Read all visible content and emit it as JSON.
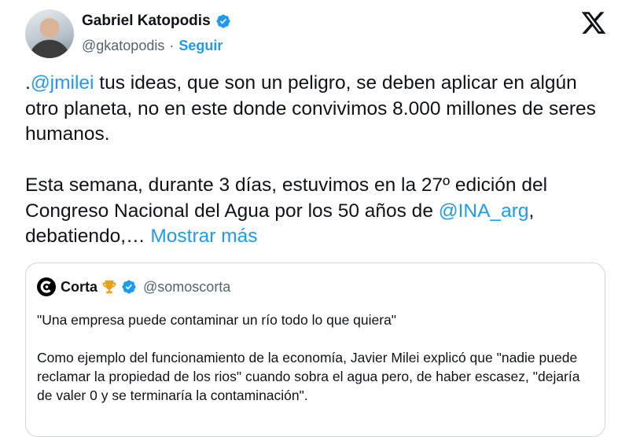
{
  "author": {
    "name": "Gabriel Katopodis",
    "handle": "@gkatopodis",
    "separator": "·",
    "follow_label": "Seguir"
  },
  "tweet": {
    "prefix": ".",
    "mention1": "@jmilei",
    "part1": " tus ideas, que son un peligro, se deben aplicar en algún otro planeta, no en este donde convivimos 8.000 millones de seres humanos.\n\nEsta semana, durante 3 días, estuvimos en la 27º edición del Congreso Nacional del Agua por los 50 años de ",
    "mention2": "@INA_arg",
    "part2": ", debatiendo,… ",
    "show_more": "Mostrar más"
  },
  "quote": {
    "name": "Corta",
    "handle": "@somoscorta",
    "line1": "\"Una empresa puede contaminar un río todo lo que quiera\"",
    "paragraph": "Como ejemplo del funcionamiento de la economía, Javier Milei explicó que \"nadie puede reclamar la propiedad de los rios\" cuando sobra el agua pero, de haber escasez, \"dejaría de valer 0 y se terminaría la contaminación\"."
  },
  "icons": {
    "verified": "verified-badge-icon",
    "x_logo": "x-logo-icon",
    "trophy": "trophy-icon",
    "corta_logo": "corta-logo-icon"
  },
  "colors": {
    "accent": "#1d9bf0",
    "text": "#0f1419",
    "secondary": "#536471",
    "border": "#cfd9de"
  }
}
